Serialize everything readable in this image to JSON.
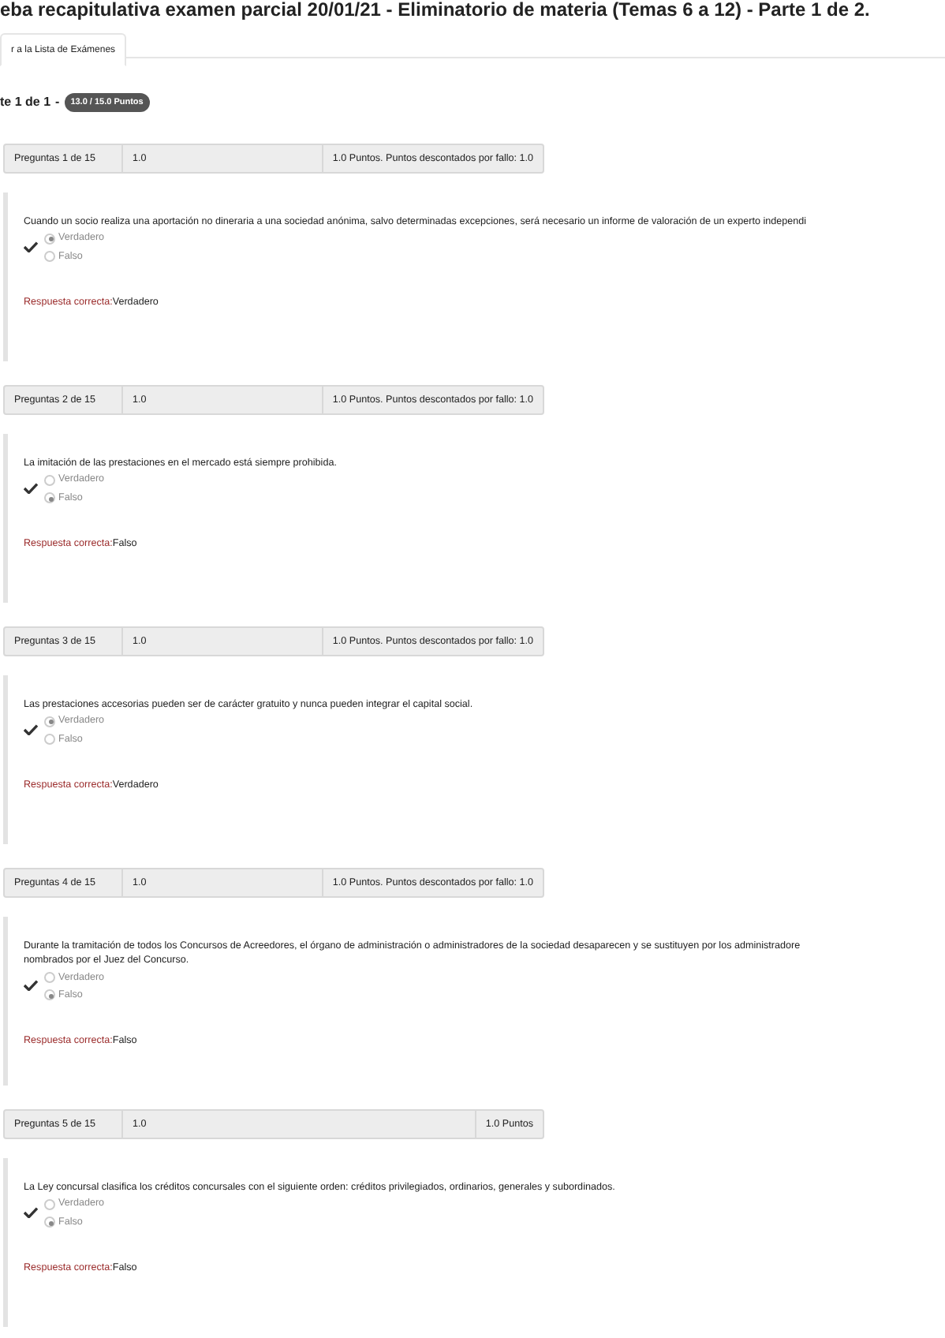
{
  "title": "eba recapitulativa examen parcial 20/01/21 - Eliminatorio de materia (Temas 6 a 12) - Parte 1 de 2.",
  "tabs": [
    {
      "label": "r a la Lista de Exámenes",
      "selected": true
    }
  ],
  "part": {
    "label": "te 1 de 1",
    "separator": "-",
    "score": "13.0 / 15.0 Puntos"
  },
  "questions": [
    {
      "number": "Preguntas 1 de 15",
      "score": "1.0",
      "points": "1.0 Puntos. Puntos descontados por fallo: 1.0",
      "text": "Cuando un socio realiza una aportación no dineraria a una sociedad anónima, salvo determinadas excepciones, será necesario un informe de valoración de un experto independi",
      "correct": true,
      "options": [
        {
          "label": "Verdadero",
          "selected": true
        },
        {
          "label": "Falso",
          "selected": false
        }
      ],
      "answer_label": "Respuesta correcta:",
      "answer": "Verdadero"
    },
    {
      "number": "Preguntas 2 de 15",
      "score": "1.0",
      "points": "1.0 Puntos. Puntos descontados por fallo: 1.0",
      "text": "La imitación de las prestaciones en el mercado está siempre prohibida.",
      "correct": true,
      "options": [
        {
          "label": "Verdadero",
          "selected": false
        },
        {
          "label": "Falso",
          "selected": true
        }
      ],
      "answer_label": "Respuesta correcta:",
      "answer": "Falso"
    },
    {
      "number": "Preguntas 3 de 15",
      "score": "1.0",
      "points": "1.0 Puntos. Puntos descontados por fallo: 1.0",
      "text": "Las prestaciones accesorias pueden ser de carácter gratuito y nunca pueden integrar el capital social.",
      "correct": true,
      "options": [
        {
          "label": "Verdadero",
          "selected": true
        },
        {
          "label": "Falso",
          "selected": false
        }
      ],
      "answer_label": "Respuesta correcta:",
      "answer": "Verdadero"
    },
    {
      "number": "Preguntas 4 de 15",
      "score": "1.0",
      "points": "1.0 Puntos. Puntos descontados por fallo: 1.0",
      "text": "Durante la tramitación de todos los Concursos de Acreedores, el órgano de administración o administradores de la sociedad desaparecen y se sustituyen por los administradore\nnombrados por el Juez del Concurso.",
      "correct": true,
      "options": [
        {
          "label": "Verdadero",
          "selected": false
        },
        {
          "label": "Falso",
          "selected": true
        }
      ],
      "answer_label": "Respuesta correcta:",
      "answer": "Falso"
    },
    {
      "number": "Preguntas 5 de 15",
      "score": "1.0",
      "points": "1.0 Puntos",
      "text": "La Ley concursal clasifica los créditos concursales con el siguiente orden: créditos privilegiados, ordinarios, generales y subordinados.",
      "correct": true,
      "options": [
        {
          "label": "Verdadero",
          "selected": false
        },
        {
          "label": "Falso",
          "selected": true
        }
      ],
      "answer_label": "Respuesta correcta:",
      "answer": "Falso"
    }
  ]
}
